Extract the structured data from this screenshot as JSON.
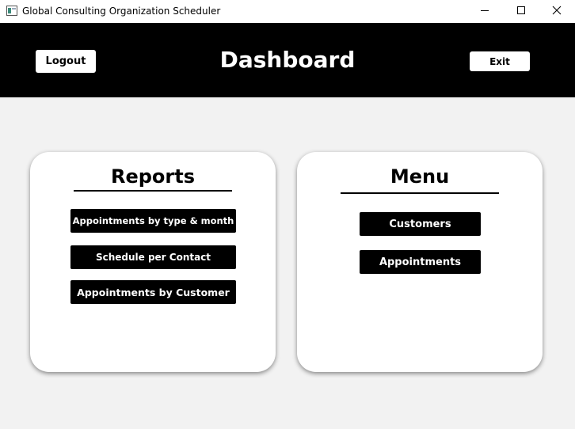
{
  "window": {
    "title": "Global Consulting Organization Scheduler",
    "icon": "app-window-icon",
    "controls": [
      "minimize-icon",
      "maximize-icon",
      "close-icon"
    ]
  },
  "header": {
    "title": "Dashboard",
    "logout_label": "Logout",
    "exit_label": "Exit",
    "background": "#000000"
  },
  "reports": {
    "title": "Reports",
    "buttons": [
      "Appointments by type & month",
      "Schedule per Contact",
      "Appointments by Customer"
    ]
  },
  "menu": {
    "title": "Menu",
    "buttons": [
      "Customers",
      "Appointments"
    ]
  },
  "colors": {
    "page_background": "#f2f2f2",
    "card_background": "#ffffff",
    "button_dark": "#000000"
  }
}
